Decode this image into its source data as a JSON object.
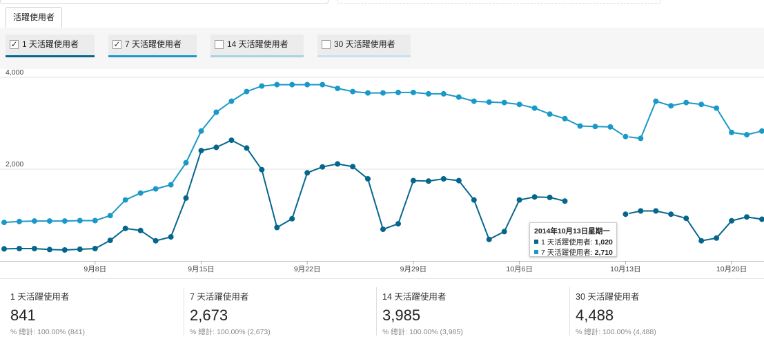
{
  "tab": {
    "label": "活躍使用者"
  },
  "toggles": [
    {
      "label": "1 天活躍使用者",
      "checked": true,
      "color": "#05668d"
    },
    {
      "label": "7 天活躍使用者",
      "checked": true,
      "color": "#1a99c8"
    },
    {
      "label": "14 天活躍使用者",
      "checked": false,
      "color": "#a7d3e4"
    },
    {
      "label": "30 天活躍使用者",
      "checked": false,
      "color": "#c4e3ee"
    }
  ],
  "tooltip": {
    "title": "2014年10月13日星期一",
    "rows": [
      {
        "label": "1 天活躍使用者:",
        "value": "1,020",
        "color": "#05668d"
      },
      {
        "label": "7 天活躍使用者:",
        "value": "2,710",
        "color": "#1a99c8"
      }
    ]
  },
  "stats": [
    {
      "name": "1 天活躍使用者",
      "value": "841",
      "sub": "% 總計: 100.00% (841)"
    },
    {
      "name": "7 天活躍使用者",
      "value": "2,673",
      "sub": "% 總計: 100.00% (2,673)"
    },
    {
      "name": "14 天活躍使用者",
      "value": "3,985",
      "sub": "% 總計: 100.00% (3,985)"
    },
    {
      "name": "30 天活躍使用者",
      "value": "4,488",
      "sub": "% 總計: 100.00% (4,488)"
    }
  ],
  "chart_data": {
    "type": "line",
    "ylim": [
      0,
      4000
    ],
    "yticks": [
      "2,000",
      "4,000"
    ],
    "ytick_values": [
      2000,
      4000
    ],
    "xtick_labels": [
      "9月8日",
      "9月15日",
      "9月22日",
      "9月29日",
      "10月6日",
      "10月13日",
      "10月20日"
    ],
    "xtick_index": [
      6,
      13,
      20,
      27,
      34,
      41,
      48
    ],
    "grid": true,
    "highlight_index": 41,
    "series": [
      {
        "name": "1 天活躍使用者",
        "color": "#05668d",
        "values": [
          265,
          270,
          270,
          250,
          240,
          255,
          270,
          450,
          710,
          665,
          440,
          525,
          1370,
          2405,
          2475,
          2630,
          2460,
          1990,
          730,
          920,
          1920,
          2050,
          2115,
          2055,
          1790,
          690,
          810,
          1750,
          1740,
          1790,
          1750,
          1330,
          470,
          640,
          1330,
          1395,
          1385,
          1305,
          null,
          null,
          null,
          1020,
          1090,
          1090,
          1020,
          930,
          440,
          500,
          875,
          960,
          910
        ]
      },
      {
        "name": "7 天活躍使用者",
        "color": "#1a99c8",
        "values": [
          840,
          860,
          870,
          870,
          870,
          880,
          880,
          990,
          1330,
          1480,
          1570,
          1660,
          2140,
          2830,
          3240,
          3480,
          3690,
          3810,
          3840,
          3840,
          3840,
          3840,
          3760,
          3690,
          3660,
          3660,
          3670,
          3670,
          3640,
          3640,
          3570,
          3480,
          3460,
          3450,
          3410,
          3330,
          3200,
          3100,
          2940,
          2930,
          2920,
          2710,
          2670,
          3480,
          3380,
          3450,
          3410,
          3330,
          2800,
          2750,
          2830
        ]
      }
    ]
  }
}
